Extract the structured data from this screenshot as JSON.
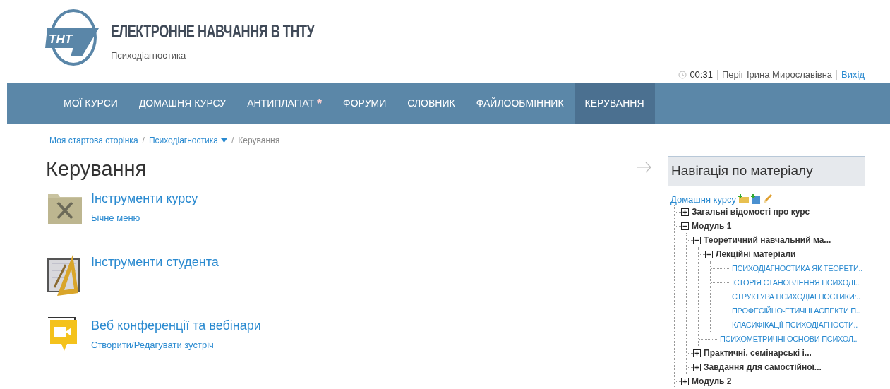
{
  "header": {
    "title": "ЕЛЕКТРОННЕ НАВЧАННЯ В ТНТУ",
    "subtitle": "Психодіагностика",
    "logo_text": "ТНТ"
  },
  "user_bar": {
    "time": "00:31",
    "user": "Періг Ірина Мирославівна",
    "logout": "Вихід"
  },
  "nav": [
    {
      "label": "МОЇ КУРСИ",
      "selected": false
    },
    {
      "label": "ДОМАШНЯ КУРСУ",
      "selected": false
    },
    {
      "label": "АНТИПЛАГІАТ",
      "marker": "*",
      "selected": false
    },
    {
      "label": "ФОРУМИ",
      "selected": false
    },
    {
      "label": "СЛОВНИК",
      "selected": false
    },
    {
      "label": "ФАЙЛООБМІННИК",
      "selected": false
    },
    {
      "label": "КЕРУВАННЯ",
      "selected": true
    }
  ],
  "breadcrumb_separator": "/",
  "breadcrumb": [
    {
      "label": "Моя стартова сторінка",
      "kind": "link"
    },
    {
      "label": "Психодіагностика",
      "kind": "dropdown"
    },
    {
      "label": "Керування",
      "kind": "current"
    }
  ],
  "page_title": "Керування",
  "tools": [
    {
      "kind": "folder",
      "title": "Інструменти курсу",
      "link": "Бічне меню"
    },
    {
      "kind": "drafting",
      "title": "Інструменти студента"
    },
    {
      "kind": "video",
      "title": "Веб конференції та вебінари",
      "link": "Створити/Редагувати зустріч"
    }
  ],
  "side_block": {
    "title": "Навігація по матеріалу",
    "root": "Домашня курсу",
    "tree": [
      {
        "kind": "folder",
        "title": "Загальні відомості про курс",
        "expanded": false
      },
      {
        "kind": "folder",
        "title": "Модуль 1",
        "expanded": true,
        "children": [
          {
            "kind": "folder",
            "title": "Теоретичний навчальний ма...",
            "expanded": true,
            "children": [
              {
                "kind": "folder",
                "title": "Лекційні матеріали",
                "expanded": true,
                "children": [
                  {
                    "kind": "link",
                    "title": "ПСИХОДІАГНОСТИКА ЯК ТЕОРЕТИ.."
                  },
                  {
                    "kind": "link",
                    "title": "ІСТОРІЯ СТАНОВЛЕННЯ ПСИХОДІ.."
                  },
                  {
                    "kind": "link",
                    "title": "СТРУКТУРА ПСИХОДІАГНОСТИКИ:.."
                  },
                  {
                    "kind": "link",
                    "title": "ПРОФЕСІЙНО-ЕТИЧНІ АСПЕКТИ П.."
                  },
                  {
                    "kind": "link",
                    "title": "КЛАСИФІКАЦІЇ ПСИХОДІАГНОСТИ.."
                  }
                ]
              },
              {
                "kind": "link",
                "title": "ПСИХОМЕТРИЧНІ ОСНОВИ ПСИХОЛ.."
              }
            ]
          },
          {
            "kind": "folder",
            "title": "Практичні, семінарські і...",
            "expanded": false
          },
          {
            "kind": "folder",
            "title": "Завдання для самостійної...",
            "expanded": false
          }
        ]
      },
      {
        "kind": "folder",
        "title": "Модуль 2",
        "expanded": false
      }
    ]
  }
}
